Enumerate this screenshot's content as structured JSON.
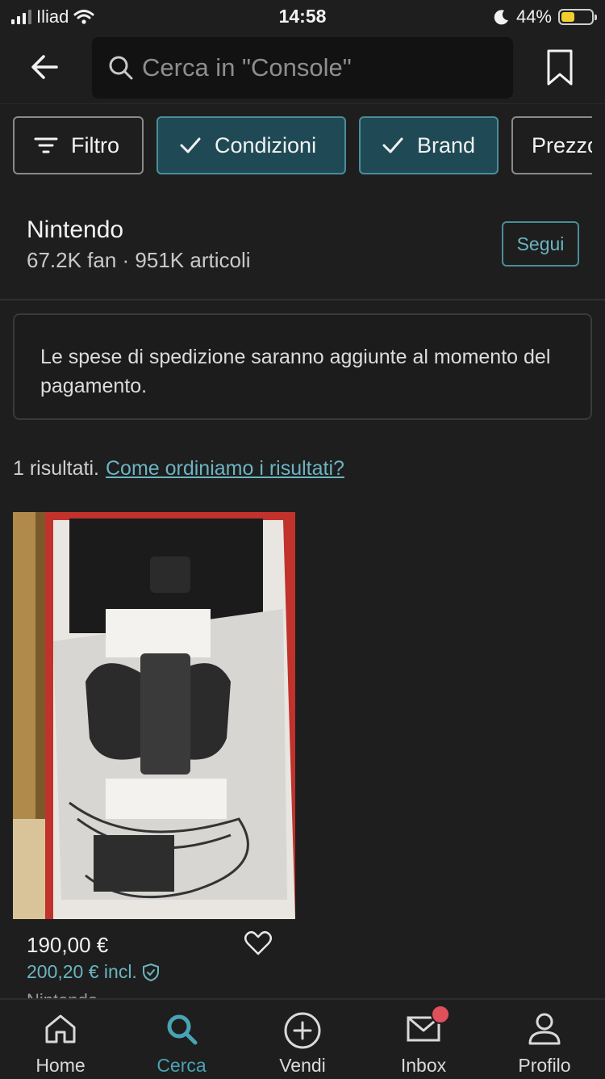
{
  "status_bar": {
    "carrier": "Iliad",
    "time": "14:58",
    "battery_percent": "44%",
    "battery_level": 0.44,
    "icons": [
      "signal-icon",
      "wifi-icon",
      "moon-icon",
      "battery-icon"
    ]
  },
  "header": {
    "search_placeholder": "Cerca in \"Console\"",
    "icons": [
      "back-arrow-icon",
      "search-icon",
      "bookmark-icon"
    ]
  },
  "filters": [
    {
      "label": "Filtro",
      "selected": false,
      "icon": "filter-icon"
    },
    {
      "label": "Condizioni",
      "selected": true,
      "icon": "check-icon"
    },
    {
      "label": "Brand",
      "selected": true,
      "icon": "check-icon"
    },
    {
      "label": "Prezzo",
      "selected": false
    }
  ],
  "brand": {
    "name": "Nintendo",
    "meta": "67.2K fan · 951K articoli",
    "follow_label": "Segui"
  },
  "notice": {
    "text": "Le spese di spedizione saranno aggiunte al momento del pagamento."
  },
  "results": {
    "count_text": "1 risultati.",
    "link_text": "Come ordiniamo i risultati?"
  },
  "item": {
    "price": "190,00 €",
    "price_incl": "200,20 € incl.",
    "brand": "Nintendo",
    "icons": [
      "heart-icon",
      "shield-check-icon"
    ]
  },
  "tabbar": {
    "tabs": [
      {
        "label": "Home",
        "icon": "home-icon",
        "active": false
      },
      {
        "label": "Cerca",
        "icon": "search-icon",
        "active": true
      },
      {
        "label": "Vendi",
        "icon": "plus-circle-icon",
        "active": false
      },
      {
        "label": "Inbox",
        "icon": "mail-icon",
        "active": false
      },
      {
        "label": "Profilo",
        "icon": "person-icon",
        "active": false
      }
    ]
  },
  "colors": {
    "background": "#1e1e1e",
    "accent": "#48a3b5",
    "chip_selected": "#1f4a55",
    "badge": "#e0505a"
  }
}
